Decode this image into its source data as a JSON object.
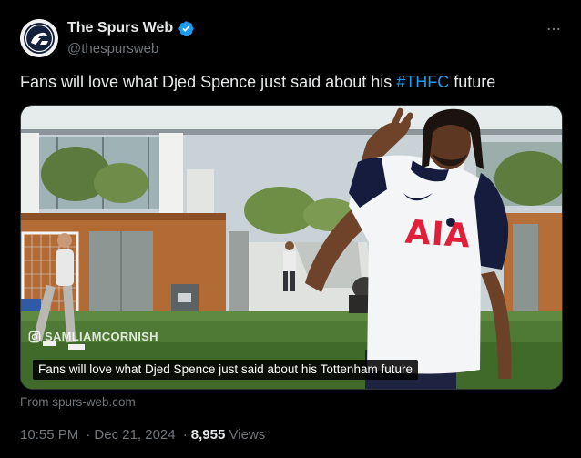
{
  "author": {
    "display_name": "The Spurs Web",
    "handle": "@thespursweb",
    "avatar_icon": "spurs-web-logo",
    "verified_icon": "verified-badge-icon",
    "verified_color": "#1d9bf0"
  },
  "more_icon": "more-options-icon",
  "tweet": {
    "text_before": "Fans will love what Djed Spence just said about his ",
    "hashtag": "#THFC",
    "text_after": " future"
  },
  "media": {
    "watermark_icon": "instagram-icon",
    "watermark_text": "SAMLIAMCORNISH",
    "caption": "Fans will love what Djed Spence just said about his Tottenham future",
    "shirt_sponsor": "AIA"
  },
  "source_text": "From spurs-web.com",
  "meta": {
    "time": "10:55 PM",
    "separator": "·",
    "date": "Dec 21, 2024",
    "views_count": "8,955",
    "views_label": "Views"
  },
  "colors": {
    "background": "#000000",
    "text_primary": "#e7e9ea",
    "text_secondary": "#71767b",
    "link": "#1d9bf0",
    "border": "#2f3336"
  }
}
